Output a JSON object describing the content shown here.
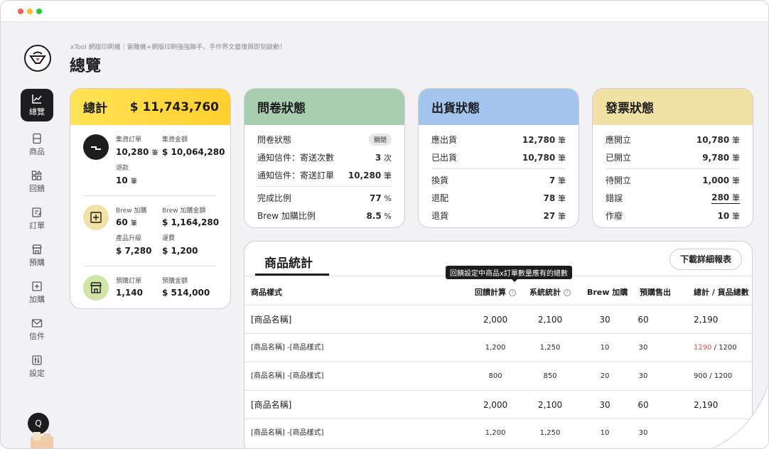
{
  "app": {
    "subtitle": "xTool 網版印刷機｜雷雕機+網版印刷強強聯手，手作界文藝復興即刻啟動！",
    "page_title": "總覽"
  },
  "sidebar": {
    "items": [
      {
        "label": "總覽",
        "icon": "chart-icon",
        "active": true
      },
      {
        "label": "商品",
        "icon": "product-icon"
      },
      {
        "label": "回饋",
        "icon": "reward-icon"
      },
      {
        "label": "訂單",
        "icon": "order-icon"
      },
      {
        "label": "預購",
        "icon": "store-icon"
      },
      {
        "label": "加購",
        "icon": "addon-icon"
      },
      {
        "label": "信件",
        "icon": "mail-icon"
      },
      {
        "label": "設定",
        "icon": "settings-icon"
      }
    ],
    "avatar": "Q"
  },
  "total": {
    "title": "總計",
    "amount": "$ 11,743,760",
    "funding": {
      "orders_label": "集資訂單",
      "orders_value": "10,280",
      "orders_unit": "筆",
      "amount_label": "集資金額",
      "amount_value": "$ 10,064,280",
      "refund_label": "退款",
      "refund_value": "10",
      "refund_unit": "筆"
    },
    "brew": {
      "orders_label": "Brew 加購",
      "orders_value": "60",
      "orders_unit": "筆",
      "amount_label": "Brew 加購金額",
      "amount_value": "$ 1,164,280",
      "upgrade_label": "產品升級",
      "upgrade_value": "$ 7,280",
      "shipping_label": "運費",
      "shipping_value": "$ 1,200"
    },
    "preorder": {
      "orders_label": "預購訂單",
      "orders_value": "1,140",
      "amount_label": "預購金額",
      "amount_value": "$ 514,000"
    }
  },
  "survey": {
    "title": "問卷狀態",
    "status_label": "問卷狀態",
    "status_value": "關閉",
    "rows": [
      {
        "label": "通知信件：寄送次數",
        "value": "3",
        "unit": "次"
      },
      {
        "label": "通知信件：寄送訂單",
        "value": "10,280",
        "unit": "筆"
      },
      {
        "label": "完成比例",
        "value": "77",
        "unit": "%"
      },
      {
        "label": "Brew 加購比例",
        "value": "8.5",
        "unit": "%"
      }
    ]
  },
  "shipping": {
    "title": "出貨狀態",
    "rows": [
      {
        "label": "應出貨",
        "value": "12,780",
        "unit": "筆"
      },
      {
        "label": "已出貨",
        "value": "10,780",
        "unit": "筆"
      },
      {
        "label": "換貨",
        "value": "7",
        "unit": "筆"
      },
      {
        "label": "退配",
        "value": "78",
        "unit": "筆"
      },
      {
        "label": "退貨",
        "value": "27",
        "unit": "筆"
      }
    ]
  },
  "invoice": {
    "title": "發票狀態",
    "rows": [
      {
        "label": "應開立",
        "value": "10,780",
        "unit": "筆"
      },
      {
        "label": "已開立",
        "value": "9,780",
        "unit": "筆"
      },
      {
        "label": "待開立",
        "value": "1,000",
        "unit": "筆"
      },
      {
        "label": "錯誤",
        "value": "280",
        "unit": "筆"
      },
      {
        "label": "作廢",
        "value": "10",
        "unit": "筆"
      }
    ]
  },
  "stats": {
    "title": "商品統計",
    "download_label": "下載詳細報表",
    "tooltip": "回饋設定中商品x訂單數量應有的總數",
    "headers": [
      "商品樣式",
      "回饋計算",
      "系統統計",
      "Brew 加購",
      "預購售出",
      "總計 / 貨品總數"
    ],
    "rows": [
      {
        "name": "[商品名稱]",
        "calc": "2,000",
        "sys": "2,100",
        "brew": "30",
        "pre": "60",
        "total": "2,190",
        "stock": "",
        "level": "big"
      },
      {
        "name": "[商品名稱] -[商品樣式]",
        "calc": "1,200",
        "sys": "1,250",
        "brew": "10",
        "pre": "30",
        "total": "1290",
        "stock": "/ 1200",
        "level": "small",
        "warn": true
      },
      {
        "name": "[商品名稱] -[商品樣式]",
        "calc": "800",
        "sys": "850",
        "brew": "20",
        "pre": "30",
        "total": "900",
        "stock": "/ 1200",
        "level": "small"
      },
      {
        "name": "[商品名稱]",
        "calc": "2,000",
        "sys": "2,100",
        "brew": "30",
        "pre": "60",
        "total": "2,190",
        "stock": "",
        "level": "big"
      },
      {
        "name": "[商品名稱] -[商品樣式]",
        "calc": "1,200",
        "sys": "1,250",
        "brew": "10",
        "pre": "30",
        "total": "",
        "stock": "",
        "level": "small"
      }
    ]
  },
  "colors": {
    "total_head": "#ffd83a",
    "survey_head": "#a8cdb0",
    "shipping_head": "#a3c5ee",
    "invoice_head": "#f1e1a4",
    "warn": "#e0524a"
  }
}
